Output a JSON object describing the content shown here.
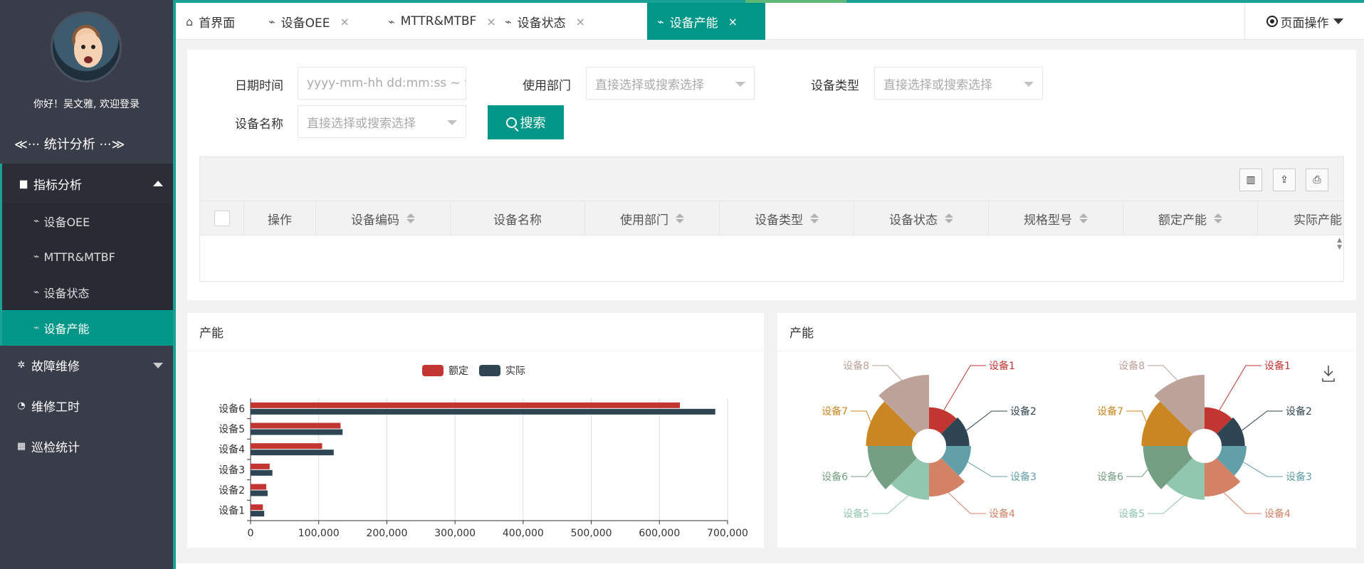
{
  "colors": {
    "accent": "#009688",
    "sidebar_bg": "#393d49",
    "planned": "#c23531",
    "actual": "#2f4554"
  },
  "user": {
    "welcome": "你好！吴文雅, 欢迎登录"
  },
  "sidebar": {
    "title": "≪··· 统计分析 ···≫",
    "zhibiao": "指标分析",
    "subitems": [
      "设备OEE",
      "MTTR&MTBF",
      "设备状态",
      "设备产能"
    ],
    "guzhang": "故障维修",
    "weixiu": "维修工时",
    "xunjian": "巡检统计"
  },
  "tabs": [
    {
      "label": "首界面",
      "icon": "home-icon"
    },
    {
      "label": "设备OEE",
      "icon": "pulse-icon"
    },
    {
      "label": "MTTR&MTBF",
      "icon": "pulse-icon"
    },
    {
      "label": "设备状态",
      "icon": "pulse-icon"
    },
    {
      "label": "设备产能",
      "icon": "pulse-icon"
    }
  ],
  "page_ops": "页面操作",
  "filters": {
    "date_label": "日期时间",
    "date_placeholder": "yyyy-mm-hh dd:mm:ss ~ yyyy-mm-hh dd:mm:ss",
    "dept_label": "使用部门",
    "type_label": "设备类型",
    "name_label": "设备名称",
    "select_placeholder": "直接选择或搜索选择",
    "search_button": "搜索"
  },
  "table": {
    "columns": [
      "操作",
      "设备编码",
      "设备名称",
      "使用部门",
      "设备类型",
      "设备状态",
      "规格型号",
      "额定产能",
      "实际产能"
    ]
  },
  "bar_panel_title": "产能",
  "pie_panel_title": "产能",
  "chart_data": [
    {
      "type": "bar",
      "orientation": "horizontal",
      "categories": [
        "设备1",
        "设备2",
        "设备3",
        "设备4",
        "设备5",
        "设备6"
      ],
      "series": [
        {
          "name": "额定",
          "values": [
            18000,
            23000,
            28000,
            105000,
            132000,
            630000
          ]
        },
        {
          "name": "实际",
          "values": [
            20000,
            25000,
            32000,
            122000,
            135000,
            682000
          ]
        }
      ],
      "xlim": [
        0,
        700000
      ],
      "xticks": [
        "0",
        "100,000",
        "200,000",
        "300,000",
        "400,000",
        "500,000",
        "600,000",
        "700,000"
      ],
      "legend": "top-center",
      "grid": true
    },
    {
      "type": "pie",
      "variant": "rose",
      "categories": [
        "设备1",
        "设备2",
        "设备3",
        "设备4",
        "设备5",
        "设备6",
        "设备7",
        "设备8"
      ],
      "values": [
        18,
        23,
        28,
        105,
        132,
        630,
        682,
        700
      ],
      "radii": [
        0.4,
        0.43,
        0.46,
        0.62,
        0.68,
        0.82,
        0.85,
        1.0
      ],
      "slice_colors": [
        "#c23531",
        "#2f4554",
        "#61a0a8",
        "#d48265",
        "#91c7ae",
        "#749f83",
        "#ca8622",
        "#bda29a"
      ],
      "count": 2
    }
  ]
}
